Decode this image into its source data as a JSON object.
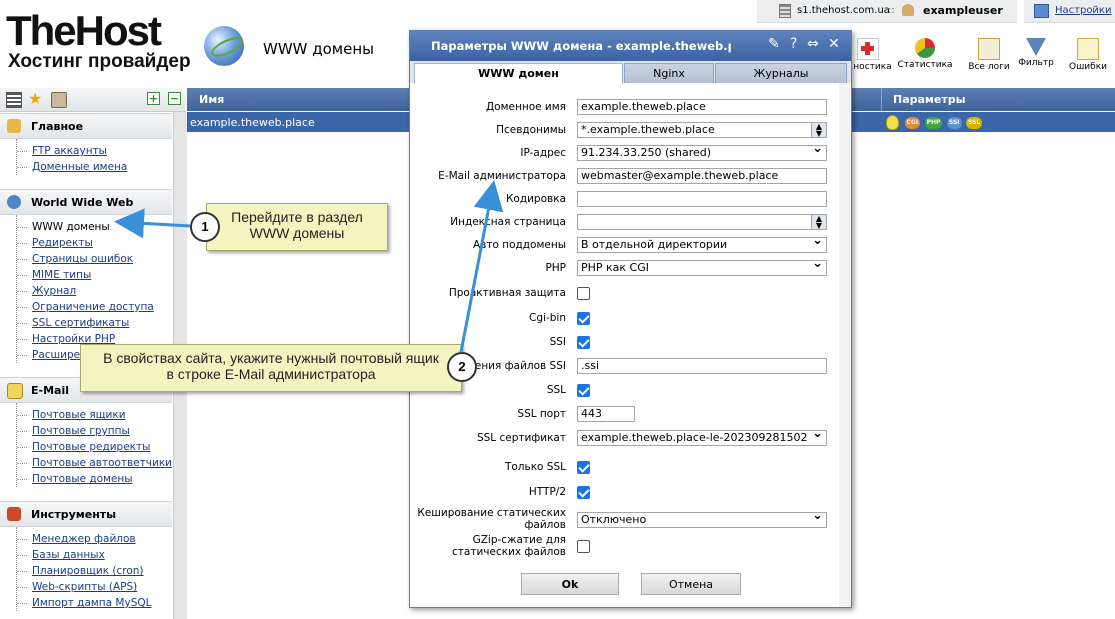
{
  "header": {
    "logo_main": "TheHost",
    "logo_sub": "Хостинг провайдер",
    "section_title": "WWW домены",
    "host": "s1.thehost.com.ua",
    "separator": "::",
    "user": "exampleuser",
    "settings": "Настройки"
  },
  "toolbar": [
    {
      "label": "…ностика",
      "icon": "first-aid-icon",
      "color": "#d62c2c"
    },
    {
      "label": "Статистика",
      "icon": "pie-chart-icon",
      "color": "#3c9a3c"
    },
    {
      "label": "Все логи",
      "icon": "logs-icon",
      "color": "#c9a33a"
    },
    {
      "label": "Фильтр",
      "icon": "filter-icon",
      "color": "#5f83bd"
    },
    {
      "label": "Ошибки",
      "icon": "warning-icon",
      "color": "#e0c020"
    }
  ],
  "sidebar": {
    "groups": [
      {
        "title": "Главное",
        "icon": "home-icon",
        "items": [
          "FTP аккаунты",
          "Доменные имена"
        ]
      },
      {
        "title": "World Wide Web",
        "icon": "globe-icon",
        "items": [
          "WWW домены",
          "Редиректы",
          "Страницы ошибок",
          "MIME типы",
          "Журнал",
          "Ограничение доступа",
          "SSL сертификаты",
          "Настройки PHP",
          "Расширения"
        ]
      },
      {
        "title": "E-Mail",
        "icon": "mail-icon",
        "items": [
          "Почтовые ящики",
          "Почтовые группы",
          "Почтовые редиректы",
          "Почтовые автоответчики",
          "Почтовые домены"
        ]
      },
      {
        "title": "Инструменты",
        "icon": "tools-icon",
        "items": [
          "Менеджер файлов",
          "Базы данных",
          "Планировщик (cron)",
          "Web-скрипты (APS)",
          "Импорт дампа MySQL"
        ]
      }
    ]
  },
  "table": {
    "col_name": "Имя",
    "col_params": "Параметры",
    "row_name": "example.theweb.place",
    "badges": [
      "CGI",
      "PHP",
      "SSI",
      "SSL"
    ],
    "badge_colors": [
      "#e08a3a",
      "#3ca83c",
      "#5f8fd0",
      "#d6b400"
    ]
  },
  "callouts": {
    "one_num": "1",
    "one_text_l1": "Перейдите в раздел",
    "one_text_l2": "WWW домены",
    "two_num": "2",
    "two_text_l1": "В свойствах сайта, укажите нужный почтовый ящик",
    "two_text_l2": "в строке E-Mail администратора"
  },
  "dialog": {
    "title": "Параметры WWW домена - example.theweb.place",
    "tabs": [
      "WWW домен",
      "Nginx",
      "Журналы"
    ],
    "fields": {
      "domain_label": "Доменное имя",
      "domain_value": "example.theweb.place",
      "alias_label": "Псевдонимы",
      "alias_value": "*.example.theweb.place",
      "ip_label": "IP-адрес",
      "ip_value": "91.234.33.250 (shared)",
      "email_label": "E-Mail администратора",
      "email_value": "webmaster@example.theweb.place",
      "charset_label": "Кодировка",
      "charset_value": "",
      "index_label": "Индексная страница",
      "index_value": "",
      "autosub_label": "Авто поддомены",
      "autosub_value": "В отдельной директории",
      "php_label": "PHP",
      "php_value": "PHP как CGI",
      "proactive_label": "Проактивная защита",
      "cgi_label": "Cgi-bin",
      "ssi_label": "SSI",
      "ssi_ext_label": "…ения файлов SSI",
      "ssi_ext_value": ".ssi",
      "ssl_label": "SSL",
      "ssl_port_label": "SSL порт",
      "ssl_port_value": "443",
      "ssl_cert_label": "SSL сертификат",
      "ssl_cert_value": "example.theweb.place-le-202309281502",
      "ssl_only_label": "Только SSL",
      "http2_label": "HTTP/2",
      "cache_label": "Кеширование статических файлов",
      "cache_value": "Отключено",
      "gzip_label": "GZip-сжатие для статических файлов"
    },
    "ok_label": "Ok",
    "cancel_label": "Отмена"
  }
}
